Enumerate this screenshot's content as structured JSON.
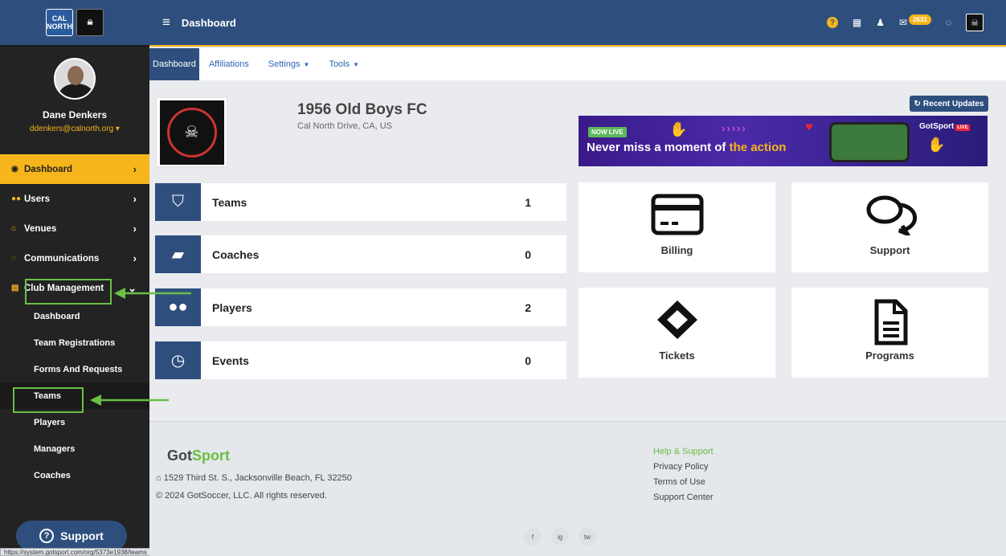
{
  "app": {
    "title": "Dashboard",
    "notifications_count": "2631"
  },
  "sidebar": {
    "logos": [
      "CAL NORTH",
      "OLD BOYS"
    ],
    "user_name": "Dane Denkers",
    "user_email": "ddenkers@calnorth.org",
    "nav": {
      "dashboard": "Dashboard",
      "users": "Users",
      "venues": "Venues",
      "communications": "Communications",
      "club_management": "Club Management"
    },
    "sub": [
      "Dashboard",
      "Team Registrations",
      "Forms And Requests",
      "Teams",
      "Players",
      "Managers",
      "Coaches"
    ],
    "support_label": "Support",
    "status_url": "https://system.gotsport.com/org/5373e1938/teams"
  },
  "tabs": {
    "dashboard": "Dashboard",
    "affiliations": "Affiliations",
    "settings": "Settings",
    "tools": "Tools"
  },
  "club": {
    "name": "1956 Old Boys FC",
    "location": "Cal North Drive, CA, US",
    "recent_updates": "Recent Updates"
  },
  "banner": {
    "live": "NOW LIVE",
    "text_a": "Never miss a moment of",
    "text_b": " the action",
    "brand": "GotSport",
    "brand_badge": "LIVE"
  },
  "stats": [
    {
      "label": "Teams",
      "count": "1"
    },
    {
      "label": "Coaches",
      "count": "0"
    },
    {
      "label": "Players",
      "count": "2"
    },
    {
      "label": "Events",
      "count": "0"
    }
  ],
  "tiles": {
    "billing": "Billing",
    "support": "Support",
    "tickets": "Tickets",
    "programs": "Programs"
  },
  "footer": {
    "logo_a": "Got",
    "logo_b": "Sport",
    "address": "1529 Third St. S., Jacksonville Beach, FL 32250",
    "copyright": "© 2024 GotSoccer, LLC. All rights reserved.",
    "links_head": "Help & Support",
    "links": [
      "Privacy Policy",
      "Terms of Use",
      "Support Center"
    ],
    "social": [
      "f",
      "ig",
      "tw"
    ]
  },
  "colors": {
    "brand_blue": "#2e4f7e",
    "accent_yellow": "#f5b51b",
    "annotation_green": "#6abf45"
  }
}
